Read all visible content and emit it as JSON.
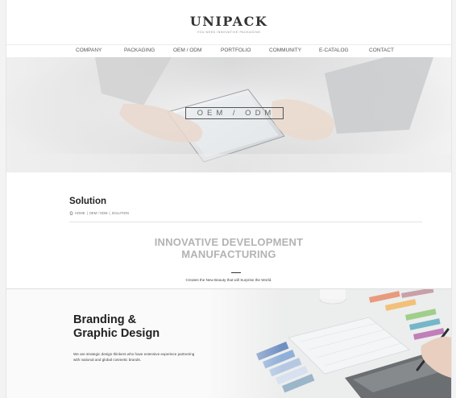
{
  "header": {
    "logo": "UNIPACK",
    "tagline": "YOU NEED INNOVATIVE PACKAGING",
    "nav": [
      "COMPANY",
      "PACKAGING",
      "OEM / ODM",
      "PORTFOLIO",
      "COMMUNITY",
      "E-CATALOG",
      "CONTACT"
    ]
  },
  "hero": {
    "title": "OEM / ODM"
  },
  "page": {
    "title": "Solution",
    "breadcrumb": [
      "HOME",
      "OEM / ODM",
      "SOLUTION"
    ]
  },
  "intro": {
    "heading_line1": "INNOVATIVE DEVELOPMENT",
    "heading_line2": "MANUFACTURING",
    "subtitle": "Creates the New Beauty that will Surprise the World."
  },
  "branding": {
    "title_line1": "Branding &",
    "title_line2": "Graphic Design",
    "desc_line1": "We are strategic design thinkers who have extensive experiece partnering",
    "desc_line2": "with national and global cosmetic brands."
  },
  "icons": {
    "breadcrumb_home": "home-icon"
  },
  "colors": {
    "heading_gray": "#b3b3b3",
    "text_dark": "#222222",
    "background": "#ffffff"
  }
}
